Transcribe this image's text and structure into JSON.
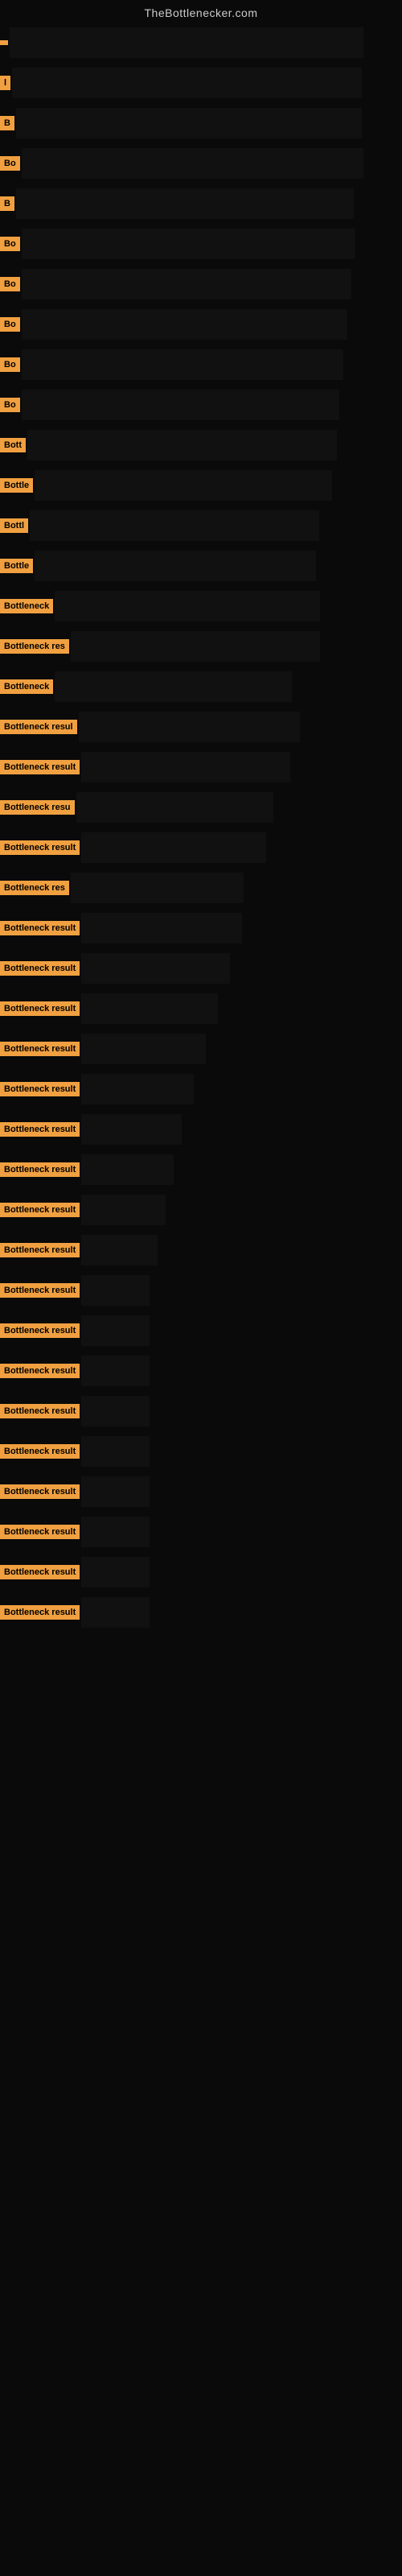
{
  "site": {
    "title": "TheBottlenecker.com"
  },
  "rows": [
    {
      "label": "",
      "barWidth": 440
    },
    {
      "label": "l",
      "barWidth": 435
    },
    {
      "label": "B",
      "barWidth": 430
    },
    {
      "label": "Bo",
      "barWidth": 425
    },
    {
      "label": "B",
      "barWidth": 420
    },
    {
      "label": "Bo",
      "barWidth": 415
    },
    {
      "label": "Bo",
      "barWidth": 410
    },
    {
      "label": "Bo",
      "barWidth": 405
    },
    {
      "label": "Bo",
      "barWidth": 400
    },
    {
      "label": "Bo",
      "barWidth": 395
    },
    {
      "label": "Bott",
      "barWidth": 385
    },
    {
      "label": "Bottle",
      "barWidth": 370
    },
    {
      "label": "Bottl",
      "barWidth": 360
    },
    {
      "label": "Bottle",
      "barWidth": 350
    },
    {
      "label": "Bottleneck",
      "barWidth": 330
    },
    {
      "label": "Bottleneck res",
      "barWidth": 310
    },
    {
      "label": "Bottleneck",
      "barWidth": 295
    },
    {
      "label": "Bottleneck resul",
      "barWidth": 275
    },
    {
      "label": "Bottleneck result",
      "barWidth": 260
    },
    {
      "label": "Bottleneck resu",
      "barWidth": 245
    },
    {
      "label": "Bottleneck result",
      "barWidth": 230
    },
    {
      "label": "Bottleneck res",
      "barWidth": 215
    },
    {
      "label": "Bottleneck result",
      "barWidth": 200
    },
    {
      "label": "Bottleneck result",
      "barWidth": 185
    },
    {
      "label": "Bottleneck result",
      "barWidth": 170
    },
    {
      "label": "Bottleneck result",
      "barWidth": 155
    },
    {
      "label": "Bottleneck result",
      "barWidth": 140
    },
    {
      "label": "Bottleneck result",
      "barWidth": 125
    },
    {
      "label": "Bottleneck result",
      "barWidth": 115
    },
    {
      "label": "Bottleneck result",
      "barWidth": 105
    },
    {
      "label": "Bottleneck result",
      "barWidth": 95
    },
    {
      "label": "Bottleneck result",
      "barWidth": 85
    },
    {
      "label": "Bottleneck result",
      "barWidth": 85
    },
    {
      "label": "Bottleneck result",
      "barWidth": 85
    },
    {
      "label": "Bottleneck result",
      "barWidth": 85
    },
    {
      "label": "Bottleneck result",
      "barWidth": 85
    },
    {
      "label": "Bottleneck result",
      "barWidth": 85
    },
    {
      "label": "Bottleneck result",
      "barWidth": 85
    },
    {
      "label": "Bottleneck result",
      "barWidth": 85
    },
    {
      "label": "Bottleneck result",
      "barWidth": 85
    }
  ]
}
